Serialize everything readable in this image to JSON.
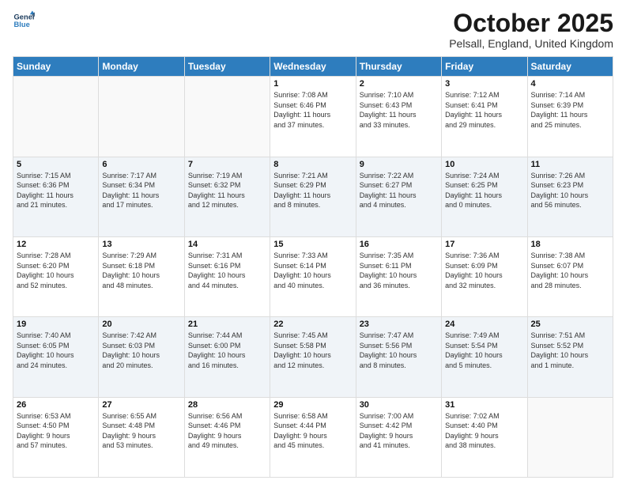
{
  "logo": {
    "line1": "General",
    "line2": "Blue"
  },
  "header": {
    "month": "October 2025",
    "location": "Pelsall, England, United Kingdom"
  },
  "weekdays": [
    "Sunday",
    "Monday",
    "Tuesday",
    "Wednesday",
    "Thursday",
    "Friday",
    "Saturday"
  ],
  "weeks": [
    [
      {
        "day": "",
        "info": ""
      },
      {
        "day": "",
        "info": ""
      },
      {
        "day": "",
        "info": ""
      },
      {
        "day": "1",
        "info": "Sunrise: 7:08 AM\nSunset: 6:46 PM\nDaylight: 11 hours\nand 37 minutes."
      },
      {
        "day": "2",
        "info": "Sunrise: 7:10 AM\nSunset: 6:43 PM\nDaylight: 11 hours\nand 33 minutes."
      },
      {
        "day": "3",
        "info": "Sunrise: 7:12 AM\nSunset: 6:41 PM\nDaylight: 11 hours\nand 29 minutes."
      },
      {
        "day": "4",
        "info": "Sunrise: 7:14 AM\nSunset: 6:39 PM\nDaylight: 11 hours\nand 25 minutes."
      }
    ],
    [
      {
        "day": "5",
        "info": "Sunrise: 7:15 AM\nSunset: 6:36 PM\nDaylight: 11 hours\nand 21 minutes."
      },
      {
        "day": "6",
        "info": "Sunrise: 7:17 AM\nSunset: 6:34 PM\nDaylight: 11 hours\nand 17 minutes."
      },
      {
        "day": "7",
        "info": "Sunrise: 7:19 AM\nSunset: 6:32 PM\nDaylight: 11 hours\nand 12 minutes."
      },
      {
        "day": "8",
        "info": "Sunrise: 7:21 AM\nSunset: 6:29 PM\nDaylight: 11 hours\nand 8 minutes."
      },
      {
        "day": "9",
        "info": "Sunrise: 7:22 AM\nSunset: 6:27 PM\nDaylight: 11 hours\nand 4 minutes."
      },
      {
        "day": "10",
        "info": "Sunrise: 7:24 AM\nSunset: 6:25 PM\nDaylight: 11 hours\nand 0 minutes."
      },
      {
        "day": "11",
        "info": "Sunrise: 7:26 AM\nSunset: 6:23 PM\nDaylight: 10 hours\nand 56 minutes."
      }
    ],
    [
      {
        "day": "12",
        "info": "Sunrise: 7:28 AM\nSunset: 6:20 PM\nDaylight: 10 hours\nand 52 minutes."
      },
      {
        "day": "13",
        "info": "Sunrise: 7:29 AM\nSunset: 6:18 PM\nDaylight: 10 hours\nand 48 minutes."
      },
      {
        "day": "14",
        "info": "Sunrise: 7:31 AM\nSunset: 6:16 PM\nDaylight: 10 hours\nand 44 minutes."
      },
      {
        "day": "15",
        "info": "Sunrise: 7:33 AM\nSunset: 6:14 PM\nDaylight: 10 hours\nand 40 minutes."
      },
      {
        "day": "16",
        "info": "Sunrise: 7:35 AM\nSunset: 6:11 PM\nDaylight: 10 hours\nand 36 minutes."
      },
      {
        "day": "17",
        "info": "Sunrise: 7:36 AM\nSunset: 6:09 PM\nDaylight: 10 hours\nand 32 minutes."
      },
      {
        "day": "18",
        "info": "Sunrise: 7:38 AM\nSunset: 6:07 PM\nDaylight: 10 hours\nand 28 minutes."
      }
    ],
    [
      {
        "day": "19",
        "info": "Sunrise: 7:40 AM\nSunset: 6:05 PM\nDaylight: 10 hours\nand 24 minutes."
      },
      {
        "day": "20",
        "info": "Sunrise: 7:42 AM\nSunset: 6:03 PM\nDaylight: 10 hours\nand 20 minutes."
      },
      {
        "day": "21",
        "info": "Sunrise: 7:44 AM\nSunset: 6:00 PM\nDaylight: 10 hours\nand 16 minutes."
      },
      {
        "day": "22",
        "info": "Sunrise: 7:45 AM\nSunset: 5:58 PM\nDaylight: 10 hours\nand 12 minutes."
      },
      {
        "day": "23",
        "info": "Sunrise: 7:47 AM\nSunset: 5:56 PM\nDaylight: 10 hours\nand 8 minutes."
      },
      {
        "day": "24",
        "info": "Sunrise: 7:49 AM\nSunset: 5:54 PM\nDaylight: 10 hours\nand 5 minutes."
      },
      {
        "day": "25",
        "info": "Sunrise: 7:51 AM\nSunset: 5:52 PM\nDaylight: 10 hours\nand 1 minute."
      }
    ],
    [
      {
        "day": "26",
        "info": "Sunrise: 6:53 AM\nSunset: 4:50 PM\nDaylight: 9 hours\nand 57 minutes."
      },
      {
        "day": "27",
        "info": "Sunrise: 6:55 AM\nSunset: 4:48 PM\nDaylight: 9 hours\nand 53 minutes."
      },
      {
        "day": "28",
        "info": "Sunrise: 6:56 AM\nSunset: 4:46 PM\nDaylight: 9 hours\nand 49 minutes."
      },
      {
        "day": "29",
        "info": "Sunrise: 6:58 AM\nSunset: 4:44 PM\nDaylight: 9 hours\nand 45 minutes."
      },
      {
        "day": "30",
        "info": "Sunrise: 7:00 AM\nSunset: 4:42 PM\nDaylight: 9 hours\nand 41 minutes."
      },
      {
        "day": "31",
        "info": "Sunrise: 7:02 AM\nSunset: 4:40 PM\nDaylight: 9 hours\nand 38 minutes."
      },
      {
        "day": "",
        "info": ""
      }
    ]
  ]
}
